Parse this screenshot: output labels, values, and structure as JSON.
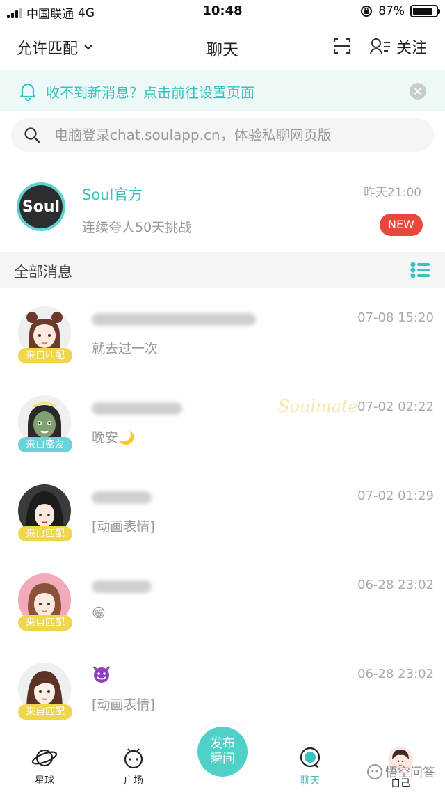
{
  "status_bar": {
    "carrier": "中国联通",
    "network": "4G",
    "time": "10:48",
    "battery": "87%",
    "battery_level": 0.87
  },
  "header": {
    "match_label": "允许匹配",
    "title": "聊天",
    "follow_label": "关注"
  },
  "notice": {
    "text": "收不到新消息？点击前往设置页面"
  },
  "search": {
    "placeholder": "电脑登录chat.soulapp.cn，体验私聊网页版"
  },
  "official": {
    "logo_text": "Soul",
    "name": "Soul官方",
    "subtitle": "连续夸人50天挑战",
    "time": "昨天21:00",
    "badge": "NEW"
  },
  "section": {
    "title": "全部消息"
  },
  "messages": [
    {
      "tag": "来自匹配",
      "tag_color": "#f0d64f",
      "preview": "就去过一次",
      "time": "07-08 15:20"
    },
    {
      "tag": "来自密友",
      "tag_color": "#69d3da",
      "preview": "晚安🌙",
      "time": "07-02 02:22",
      "watermark": "Soulmate"
    },
    {
      "tag": "来自匹配",
      "tag_color": "#f0d64f",
      "preview": "[动画表情]",
      "time": "07-02 01:29"
    },
    {
      "tag": "来自匹配",
      "tag_color": "#f0d64f",
      "preview": "😁",
      "time": "06-28 23:02"
    },
    {
      "tag": "来自匹配",
      "tag_color": "#f0d64f",
      "preview": "[动画表情]",
      "time": "06-28 23:02"
    }
  ],
  "tabbar": {
    "planet": "星球",
    "square": "广场",
    "publish": "发布瞬间",
    "chat": "聊天",
    "me": "自己",
    "accent": "#3bbfbf"
  },
  "watermark_site": "悟空问答"
}
